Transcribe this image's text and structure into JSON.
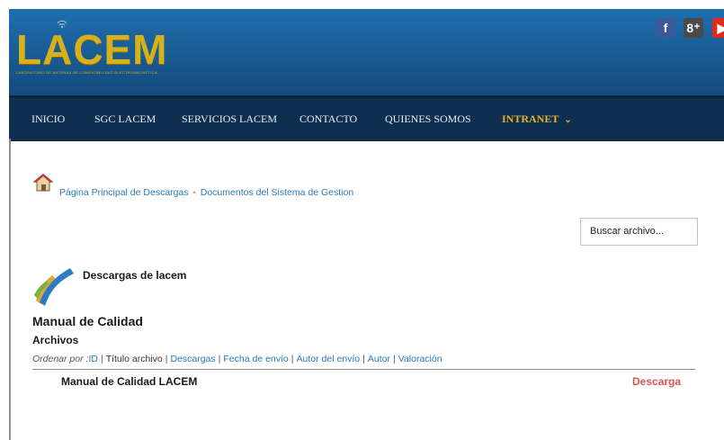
{
  "header": {
    "logo_text": "LACEM",
    "logo_subtitle": "LABORATORIO DE ANTENAS DE COMPATIBILIDAD ELECTROMAGNÉTICA",
    "social": [
      {
        "icon": "facebook-icon",
        "glyph": "f"
      },
      {
        "icon": "google-plus-icon",
        "glyph": "8⁺"
      },
      {
        "icon": "youtube-icon",
        "glyph": "▶"
      }
    ]
  },
  "nav": {
    "items": [
      {
        "label": "INICIO"
      },
      {
        "label": "SGC LACEM"
      },
      {
        "label": "SERVICIOS LACEM"
      },
      {
        "label": "CONTACTO"
      },
      {
        "label": "QUIENES SOMOS"
      },
      {
        "label": "INTRANET",
        "active": true,
        "chevron": "⌄"
      }
    ]
  },
  "breadcrumb": {
    "items": [
      "Página Principal de Descargas",
      "Documentos del Sistema de Gestion"
    ],
    "separator": "•"
  },
  "search": {
    "value": "Buscar archivo..."
  },
  "downloads": {
    "title": "Descargas de lacem"
  },
  "category": {
    "title": "Manual de Calidad",
    "files_label": "Archivos"
  },
  "sort": {
    "label": "Ordenar por :",
    "options": [
      {
        "label": "ID",
        "link": true
      },
      {
        "label": "Título archivo",
        "link": false
      },
      {
        "label": "Descargas",
        "link": true
      },
      {
        "label": "Fecha de envío",
        "link": true
      },
      {
        "label": "Autor del envío",
        "link": true
      },
      {
        "label": "Autor",
        "link": true
      },
      {
        "label": "Valoración",
        "link": true
      }
    ]
  },
  "files": [
    {
      "title": "Manual de Calidad LACEM",
      "action": "Descarga"
    }
  ],
  "colors": {
    "header_blue": "#1a5e98",
    "nav_dark": "#0e2f4f",
    "logo_gold": "#d6b11e",
    "active_nav": "#e6b22a",
    "link_blue": "#2a78b8",
    "download_red": "#d9544f"
  }
}
